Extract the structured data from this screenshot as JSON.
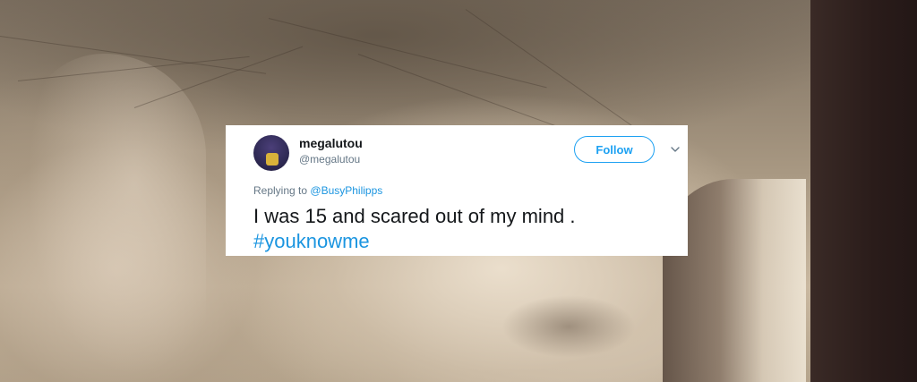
{
  "tweet": {
    "display_name": "megalutou",
    "handle": "@megalutou",
    "follow_label": "Follow",
    "replying_prefix": "Replying to",
    "replying_to": "@BusyPhilipps",
    "text": "I was 15 and scared out of my mind .",
    "hashtag": "#youknowme"
  },
  "icons": {
    "avatar": "user-avatar",
    "menu": "chevron-down-icon"
  },
  "colors": {
    "accent": "#1da1f2",
    "link": "#1b95e0",
    "text": "#14171a",
    "secondary": "#657786"
  }
}
